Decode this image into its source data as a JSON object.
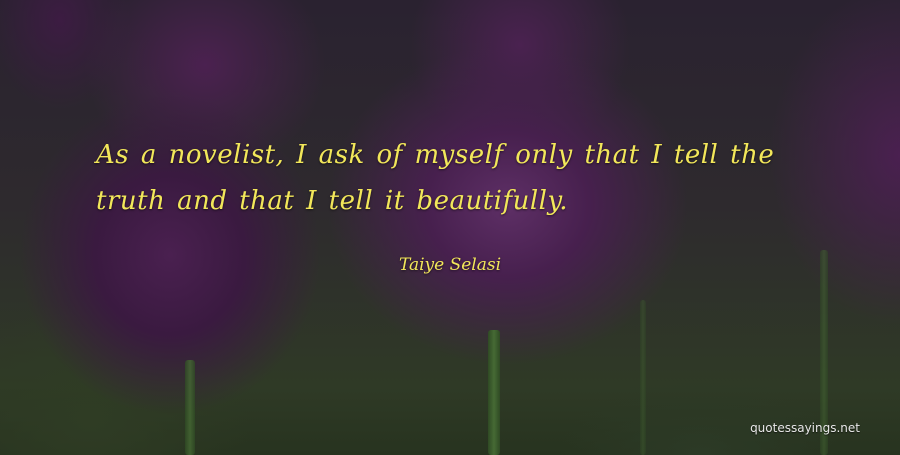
{
  "quote": {
    "text": "As a novelist, I ask of myself only that I tell the truth and that I tell it beautifully.",
    "author": "Taiye Selasi"
  },
  "watermark": "quotessayings.net",
  "colors": {
    "quote_text": "#f2e75a",
    "flower_purple": "#5e2f66",
    "background_green": "#2f3a26"
  }
}
